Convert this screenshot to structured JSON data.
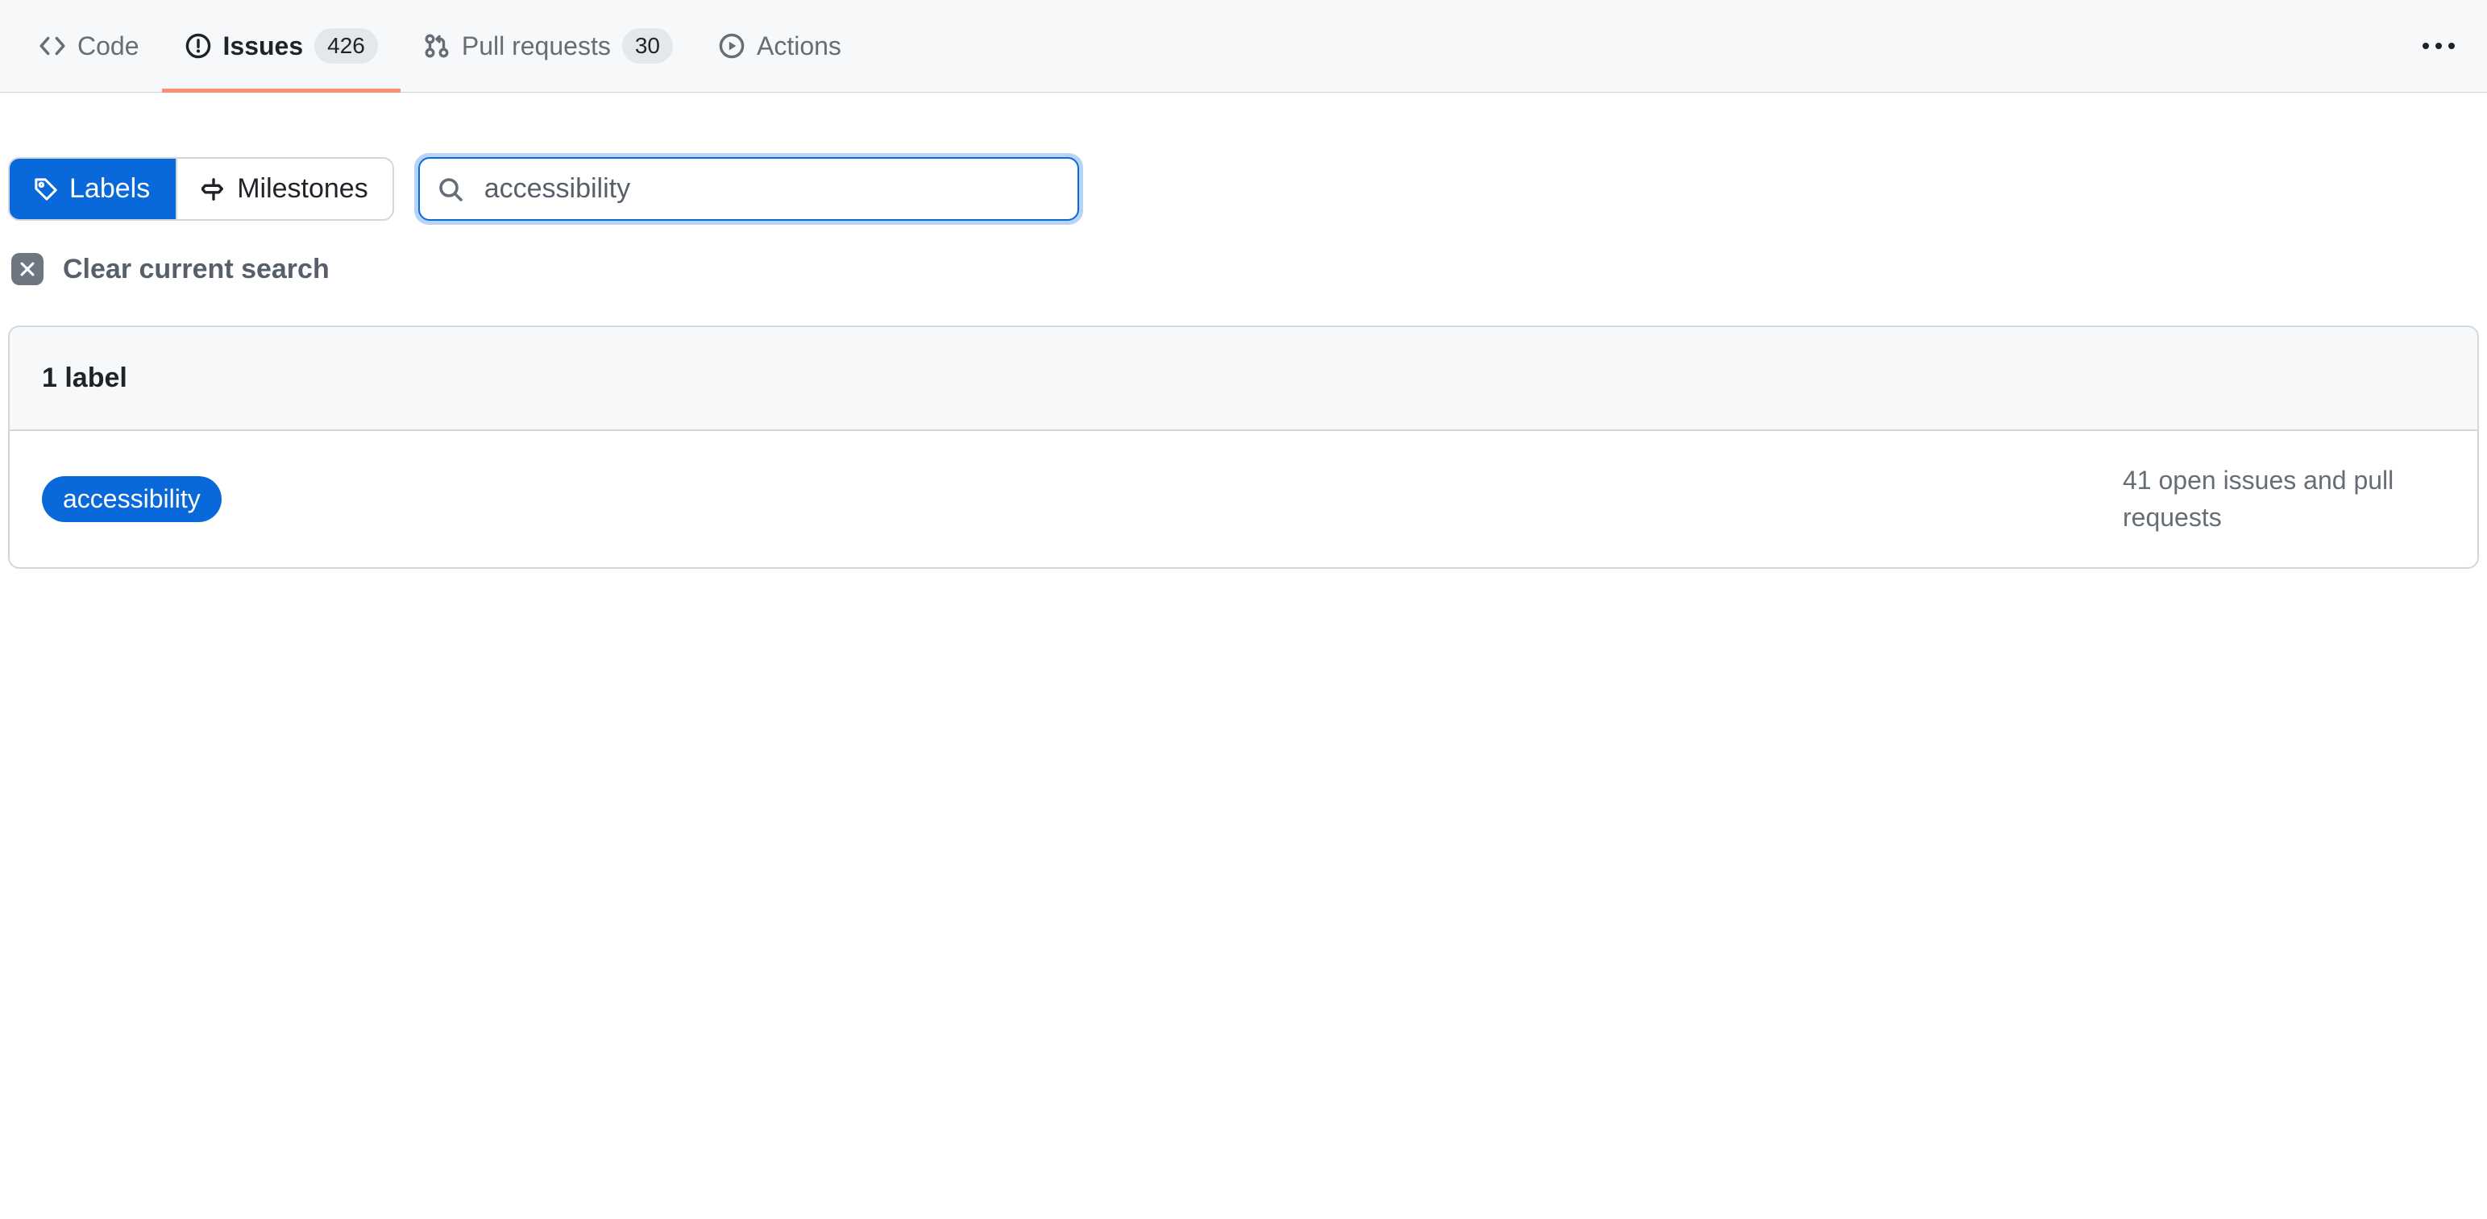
{
  "tabs": {
    "code": "Code",
    "issues": "Issues",
    "issues_count": "426",
    "pulls": "Pull requests",
    "pulls_count": "30",
    "actions": "Actions"
  },
  "toolbar": {
    "labels": "Labels",
    "milestones": "Milestones"
  },
  "search": {
    "value": "accessibility"
  },
  "clear": {
    "text": "Clear current search"
  },
  "results": {
    "header": "1 label",
    "label_name": "accessibility",
    "open_text": "41 open issues and pull requests"
  }
}
